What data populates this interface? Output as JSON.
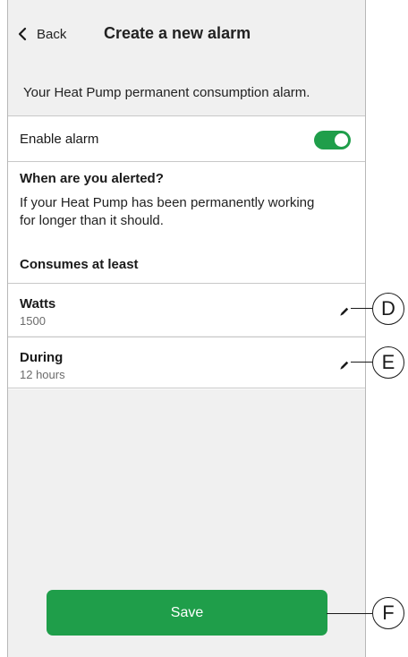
{
  "header": {
    "back_label": "Back",
    "title": "Create a new alarm"
  },
  "description": "Your Heat Pump permanent consumption alarm.",
  "enable_alarm": {
    "label": "Enable alarm",
    "enabled": true
  },
  "info": {
    "heading": "When are you alerted?",
    "text": "If your Heat Pump has been permanently working for longer than it should.",
    "subheading": "Consumes at least"
  },
  "fields": [
    {
      "label": "Watts",
      "value": "1500",
      "callout": "D"
    },
    {
      "label": "During",
      "value": "12 hours",
      "callout": "E"
    }
  ],
  "save_label": "Save",
  "save_callout": "F",
  "colors": {
    "accent_green": "#1f9e4a",
    "background": "#f0f0f0"
  },
  "icons": [
    "chevron-left-icon",
    "pencil-icon"
  ]
}
